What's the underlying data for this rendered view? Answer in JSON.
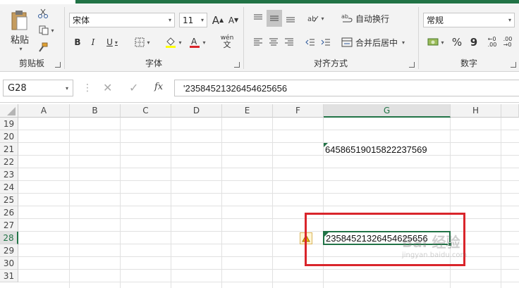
{
  "ribbon": {
    "clipboard": {
      "paste_label": "粘贴",
      "group_label": "剪贴板"
    },
    "font": {
      "font_name": "宋体",
      "font_size": "11",
      "bold": "B",
      "italic": "I",
      "underline": "U",
      "grow_font": "A",
      "shrink_font": "A",
      "phonetic": "wén",
      "group_label": "字体"
    },
    "alignment": {
      "wrap_text_label": "自动换行",
      "merge_center_label": "合并后居中",
      "group_label": "对齐方式"
    },
    "number": {
      "format": "常规",
      "percent": "%",
      "comma": "9",
      "group_label": "数字"
    }
  },
  "formula_bar": {
    "name_box": "G28",
    "fx_label": "fx",
    "content": "'23584521326454625656"
  },
  "sheet": {
    "columns": [
      "A",
      "B",
      "C",
      "D",
      "E",
      "F",
      "G",
      "H"
    ],
    "rows": [
      "19",
      "20",
      "21",
      "22",
      "23",
      "24",
      "25",
      "26",
      "27",
      "28",
      "29",
      "30",
      "31"
    ],
    "selected_column": "G",
    "selected_row": "28",
    "cells": {
      "G21": "645865190158222375​69",
      "G28": "23584521326454625656"
    }
  },
  "watermark": {
    "text": "Bai  经验",
    "sub": "jingyan.baidu.com"
  },
  "colors": {
    "accent": "#217346",
    "highlight_box": "#d9252b"
  }
}
